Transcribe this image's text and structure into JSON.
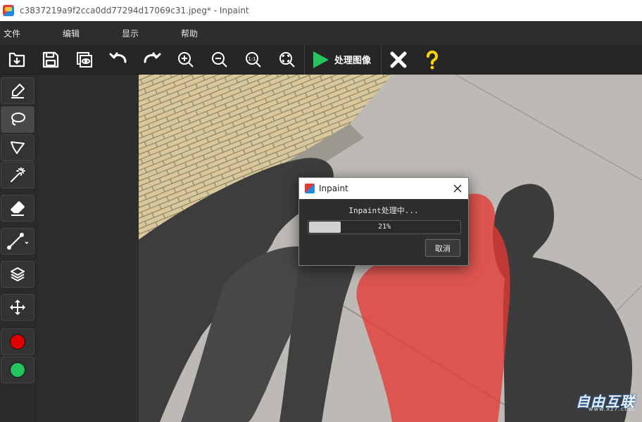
{
  "window": {
    "title": "c3837219a9f2cca0dd77294d17069c31.jpeg* - Inpaint"
  },
  "menu": [
    "文件",
    "编辑",
    "显示",
    "帮助"
  ],
  "toolbar": {
    "buttons": [
      "open-icon",
      "save-icon",
      "save-as-icon",
      "undo-icon",
      "redo-icon",
      "zoom-in-icon",
      "zoom-out-icon",
      "actual-size-icon",
      "fit-to-screen-icon"
    ],
    "process_label": "处理图像",
    "close_icon": "close-icon",
    "help_icon": "help-icon",
    "colors": {
      "play": "#22c55e",
      "help": "#ffd400"
    }
  },
  "left_tools": [
    "marker-icon",
    "lasso-icon",
    "polygonal-lasso-icon",
    "magic-wand-icon",
    "eraser-icon",
    "line-tool-icon",
    "layers-icon",
    "move-icon"
  ],
  "colors": {
    "primary": "#e00000",
    "secondary": "#22c55e",
    "mask": "#e53935"
  },
  "dialog": {
    "title": "Inpaint",
    "message": "Inpaint处理中...",
    "progress_percent": 21,
    "progress_text": "21%",
    "cancel_label": "取消"
  },
  "watermark": {
    "text": "自由互联",
    "url": "www.xz7.com"
  }
}
